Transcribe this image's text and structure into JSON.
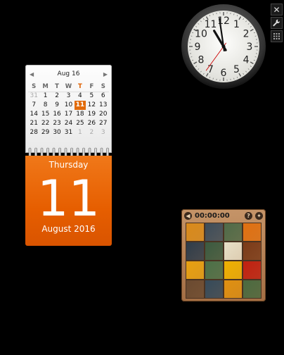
{
  "clock": {
    "numbers": [
      "12",
      "1",
      "2",
      "3",
      "4",
      "5",
      "6",
      "7",
      "8",
      "9",
      "10",
      "11"
    ],
    "hour": 10,
    "minute": 58,
    "second": 36
  },
  "controls": {
    "close_icon": "close-icon",
    "options_icon": "wrench-icon",
    "drag_icon": "drag-handle-icon",
    "close_glyph": "✕",
    "options_glyph": "🔧",
    "drag_glyph": "⁞⁞"
  },
  "calendar": {
    "month_label": "Aug 16",
    "prev_glyph": "◀",
    "next_glyph": "▶",
    "weekdays": [
      "S",
      "M",
      "T",
      "W",
      "T",
      "F",
      "S"
    ],
    "weeks": [
      [
        {
          "d": "31",
          "other": true
        },
        {
          "d": "1"
        },
        {
          "d": "2"
        },
        {
          "d": "3"
        },
        {
          "d": "4"
        },
        {
          "d": "5"
        },
        {
          "d": "6"
        }
      ],
      [
        {
          "d": "7"
        },
        {
          "d": "8"
        },
        {
          "d": "9"
        },
        {
          "d": "10"
        },
        {
          "d": "11",
          "today": true
        },
        {
          "d": "12"
        },
        {
          "d": "13"
        }
      ],
      [
        {
          "d": "14"
        },
        {
          "d": "15"
        },
        {
          "d": "16"
        },
        {
          "d": "17"
        },
        {
          "d": "18"
        },
        {
          "d": "19"
        },
        {
          "d": "20"
        }
      ],
      [
        {
          "d": "21"
        },
        {
          "d": "22"
        },
        {
          "d": "23"
        },
        {
          "d": "24"
        },
        {
          "d": "25"
        },
        {
          "d": "26"
        },
        {
          "d": "27"
        }
      ],
      [
        {
          "d": "28"
        },
        {
          "d": "29"
        },
        {
          "d": "30"
        },
        {
          "d": "31"
        },
        {
          "d": "1",
          "other": true
        },
        {
          "d": "2",
          "other": true
        },
        {
          "d": "3",
          "other": true
        }
      ]
    ],
    "today_col": 4,
    "weekday_name": "Thursday",
    "day_number": "11",
    "month_year": "August 2016",
    "accent": "#e65e00"
  },
  "puzzle": {
    "time": "00:00:00",
    "prev_glyph": "◀",
    "help_glyph": "?",
    "options_glyph": "✦",
    "tiles": [
      "#d98a1a",
      "#3c4c5a",
      "#4e6a48",
      "#e07010",
      "#2e3c4a",
      "#3a5a40",
      "#e8e0c8",
      "#7a3a18",
      "#e8a010",
      "#4a7048",
      "#f0b000",
      "#c02010",
      "#6a4a30",
      "#354a5a",
      "#e09010",
      "#4a6a40"
    ]
  }
}
